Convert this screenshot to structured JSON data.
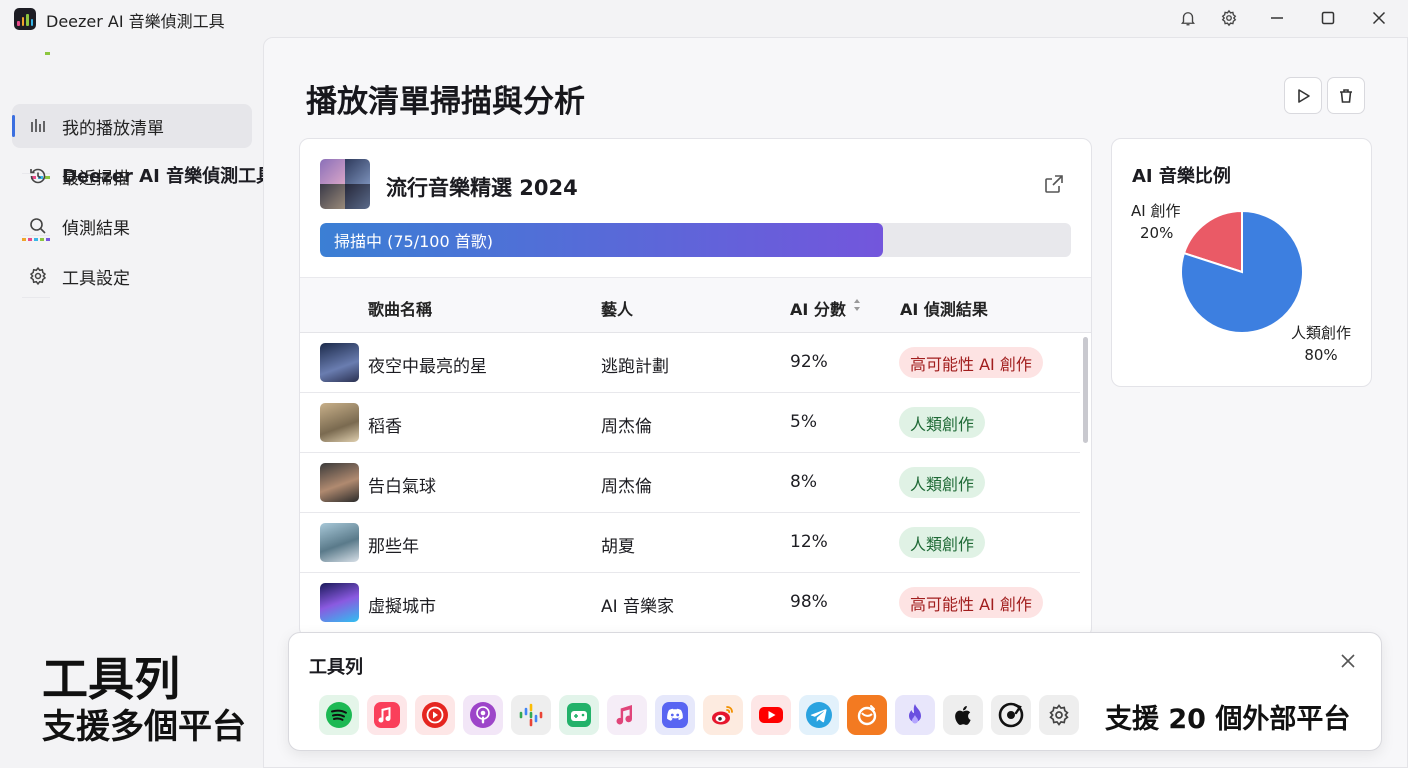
{
  "window": {
    "title": "Deezer AI 音樂偵測工具",
    "icons": [
      "bell-icon",
      "gear-icon",
      "minimize-icon",
      "maximize-icon",
      "close-icon"
    ]
  },
  "sidebar": {
    "brand": "Deezer AI 音樂偵測工具",
    "items": [
      {
        "label": "我的播放清單",
        "icon": "bars-icon",
        "active": true
      },
      {
        "label": "最近掃描",
        "icon": "history-icon",
        "active": false
      },
      {
        "label": "偵測結果",
        "icon": "search-icon",
        "active": false
      },
      {
        "label": "工具設定",
        "icon": "gear-icon",
        "active": false
      }
    ]
  },
  "main": {
    "title": "播放清單掃描與分析",
    "actions": [
      "play-icon",
      "trash-icon"
    ]
  },
  "playlist": {
    "name": "流行音樂精選 2024",
    "progress_text": "掃描中 (75/100 首歌)",
    "progress": 0.75,
    "columns": {
      "song": "歌曲名稱",
      "artist": "藝人",
      "score": "AI 分數",
      "result": "AI 偵測結果"
    },
    "rows": [
      {
        "song": "夜空中最亮的星",
        "artist": "逃跑計劃",
        "score": "92%",
        "result": "高可能性 AI 創作",
        "type": "ai"
      },
      {
        "song": "稻香",
        "artist": "周杰倫",
        "score": "5%",
        "result": "人類創作",
        "type": "human"
      },
      {
        "song": "告白氣球",
        "artist": "周杰倫",
        "score": "8%",
        "result": "人類創作",
        "type": "human"
      },
      {
        "song": "那些年",
        "artist": "胡夏",
        "score": "12%",
        "result": "人類創作",
        "type": "human"
      },
      {
        "song": "虛擬城市",
        "artist": "AI 音樂家",
        "score": "98%",
        "result": "高可能性 AI 創作",
        "type": "ai"
      }
    ]
  },
  "pie": {
    "title": "AI 音樂比例",
    "ai_label": "AI 創作",
    "ai_pct": "20%",
    "human_label": "人類創作",
    "human_pct": "80%"
  },
  "chart_data": {
    "type": "pie",
    "title": "AI 音樂比例",
    "labels": [
      "AI 創作",
      "人類創作"
    ],
    "values": [
      20,
      80
    ],
    "colors": [
      "#ea5a66",
      "#3d7fe0"
    ]
  },
  "caption": {
    "line1": "工具列",
    "line2": "支援多個平台"
  },
  "toolbar": {
    "title": "工具列",
    "caption": "支援 20 個外部平台",
    "platforms": [
      "spotify-icon",
      "apple-music-icon",
      "youtube-music-icon",
      "podcasts-icon",
      "google-podcasts-icon",
      "game-controller-icon",
      "music-note-icon",
      "discord-icon",
      "weibo-icon",
      "youtube-icon",
      "telegram-icon",
      "orange-app-icon",
      "flame-app-icon",
      "apple-icon",
      "vinyl-app-icon",
      "settings-icon"
    ]
  }
}
